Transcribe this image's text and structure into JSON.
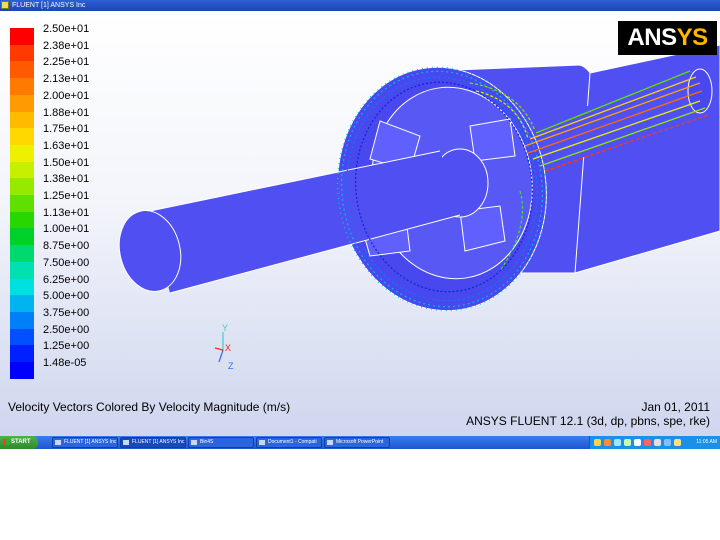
{
  "window": {
    "title": "FLUENT [1] ANSYS Inc"
  },
  "logo": {
    "text_main": "ANS",
    "text_accent": "YS"
  },
  "legend": {
    "levels": [
      {
        "label": "2.50e+01",
        "color": "#ff0000"
      },
      {
        "label": "2.38e+01",
        "color": "#ff3a00"
      },
      {
        "label": "2.25e+01",
        "color": "#ff5a00"
      },
      {
        "label": "2.13e+01",
        "color": "#ff7a00"
      },
      {
        "label": "2.00e+01",
        "color": "#ff9a00"
      },
      {
        "label": "1.88e+01",
        "color": "#ffbb00"
      },
      {
        "label": "1.75e+01",
        "color": "#ffd800"
      },
      {
        "label": "1.63e+01",
        "color": "#eef000"
      },
      {
        "label": "1.50e+01",
        "color": "#c6f000"
      },
      {
        "label": "1.38e+01",
        "color": "#96ea00"
      },
      {
        "label": "1.25e+01",
        "color": "#60e000"
      },
      {
        "label": "1.13e+01",
        "color": "#28d600"
      },
      {
        "label": "1.00e+01",
        "color": "#00d02a"
      },
      {
        "label": "8.75e+00",
        "color": "#00d870"
      },
      {
        "label": "7.50e+00",
        "color": "#00e0b0"
      },
      {
        "label": "6.25e+00",
        "color": "#00e0e0"
      },
      {
        "label": "5.00e+00",
        "color": "#00b4f0"
      },
      {
        "label": "3.75e+00",
        "color": "#0080f8"
      },
      {
        "label": "2.50e+00",
        "color": "#0050ff"
      },
      {
        "label": "1.25e+00",
        "color": "#0020ff"
      },
      {
        "label": "1.48e-05",
        "color": "#0000ff"
      }
    ]
  },
  "triad": {
    "y_label": "Y",
    "x_label": "X",
    "z_label": "Z"
  },
  "caption": "Velocity Vectors Colored By Velocity Magnitude (m/s)",
  "date": "Jan 01, 2011",
  "solver_info": "ANSYS FLUENT 12.1 (3d, dp, pbns, spe, rke)",
  "taskbar": {
    "start_label": "START",
    "items": [
      "FLUENT [1] ANSYS Inc",
      "FLUENT [1] ANSYS Inc",
      "Bin4S",
      "Document1 - Compati",
      "Microsoft PowerPoint"
    ],
    "clock": "11:05 AM"
  },
  "colors": {
    "geometry_blue": "#5050f2",
    "titlebar": "#2456c8",
    "taskbar": "#2a64df"
  }
}
